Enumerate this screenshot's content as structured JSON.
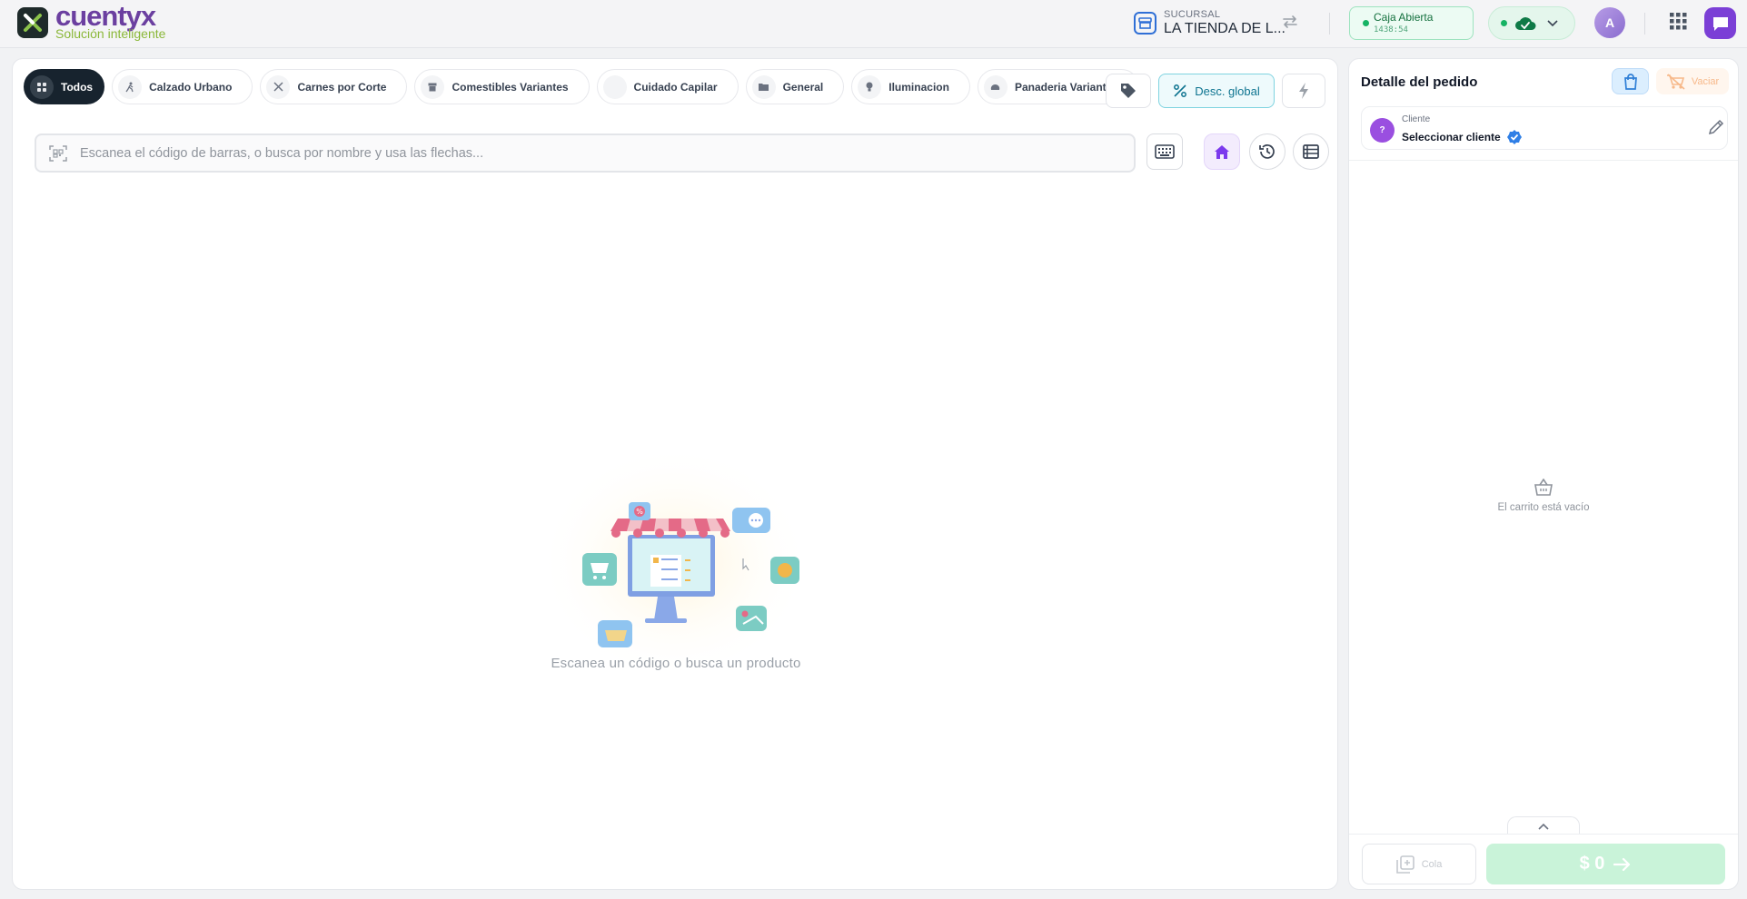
{
  "header": {
    "logo_name": "cuentyx",
    "logo_tagline": "Solución inteligente",
    "branch_label": "SUCURSAL",
    "branch_name": "LA TIENDA DE L...",
    "caja_status": "Caja Abierta",
    "caja_time": "1438:54",
    "avatar_initial": "A"
  },
  "categories": [
    {
      "label": "Todos",
      "icon": "grid-icon",
      "active": true
    },
    {
      "label": "Calzado Urbano",
      "icon": "runner-icon"
    },
    {
      "label": "Carnes por Corte",
      "icon": "utensils-icon"
    },
    {
      "label": "Comestibles Variantes",
      "icon": "archive-icon"
    },
    {
      "label": "Cuidado Capilar",
      "icon": "blank-icon"
    },
    {
      "label": "General",
      "icon": "folder-icon"
    },
    {
      "label": "Iluminacion",
      "icon": "bulb-icon"
    },
    {
      "label": "Panaderia Variantes",
      "icon": "bread-icon"
    }
  ],
  "toolbar": {
    "discount_label": "Desc. global"
  },
  "search": {
    "placeholder": "Escanea el código de barras, o busca por nombre y usa las flechas...",
    "value": ""
  },
  "empty_state": {
    "message": "Escanea un código o busca un producto"
  },
  "order": {
    "title": "Detalle del pedido",
    "clear_label": "Vaciar",
    "client_label": "Cliente",
    "client_name": "Seleccionar cliente",
    "client_avatar": "?",
    "empty_cart": "El carrito está vacío",
    "queue_label": "Cola",
    "total": "$ 0"
  },
  "colors": {
    "brand": "#6b3fa0",
    "accent_green": "#16b364",
    "active_chip": "#17232e",
    "discount": "#0e7490"
  }
}
